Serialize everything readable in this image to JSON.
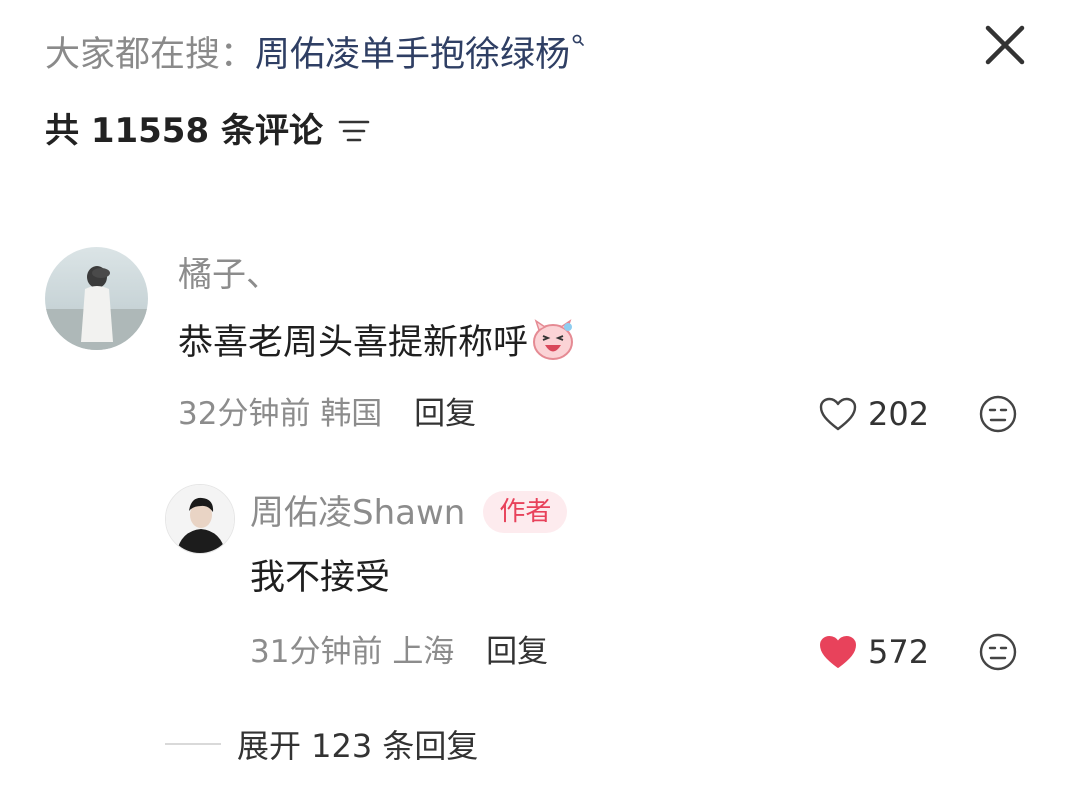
{
  "header": {
    "search_prefix": "大家都在搜：",
    "search_term": "周佑凌单手抱徐绿杨",
    "search_icon": "search-icon",
    "close_icon": "close-icon"
  },
  "comments_header": {
    "count_text": "共 11558 条评论",
    "filter_icon": "sort-filter-icon"
  },
  "comments": [
    {
      "username": "橘子、",
      "content": "恭喜老周头喜提新称呼",
      "emoji": "laughing-pig-emoji",
      "time": "32分钟前",
      "location": "韩国",
      "reply_label": "回复",
      "likes": "202",
      "liked": false
    }
  ],
  "reply": {
    "username": "周佑凌Shawn",
    "badge": "作者",
    "content": "我不接受",
    "time": "31分钟前",
    "location": "上海",
    "reply_label": "回复",
    "likes": "572",
    "liked": true
  },
  "expand": {
    "label": "展开 123 条回复"
  },
  "colors": {
    "search_term": "#2f3f64",
    "author_badge_text": "#e8425b",
    "author_badge_bg": "#fdebee",
    "like_active": "#e8425b",
    "muted_text": "#8c8c8c"
  }
}
